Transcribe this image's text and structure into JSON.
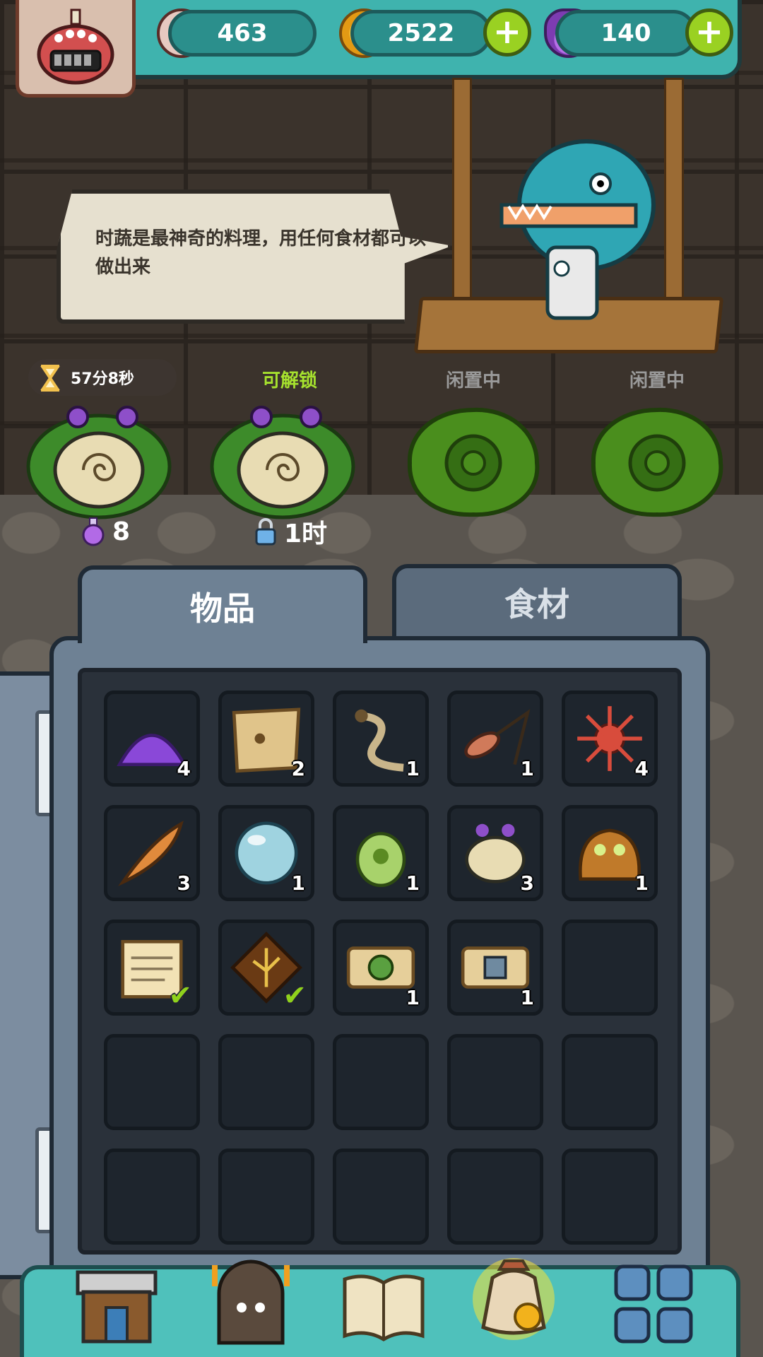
{
  "currency": {
    "eyes": "463",
    "coins": "2522",
    "potions": "140"
  },
  "chef": {
    "speech": "时蔬是最神奇的料理，用任何食材都可以做出来"
  },
  "slots": [
    {
      "status": "57分8秒",
      "bottom_value": "8",
      "bottom_icon": "potion-icon"
    },
    {
      "status": "可解锁",
      "bottom_value": "1时",
      "bottom_icon": "lock-icon"
    },
    {
      "status": "闲置中"
    },
    {
      "status": "闲置中"
    }
  ],
  "colors": {
    "unlock_green": "#a6e22e",
    "idle_gray": "#9a9a9a"
  },
  "tabs": {
    "items": "物品",
    "ingredients": "食材"
  },
  "inventory": [
    {
      "icon": "purple-powder-icon",
      "count": "4"
    },
    {
      "icon": "torn-parchment-icon",
      "count": "2"
    },
    {
      "icon": "snake-tail-icon",
      "count": "1"
    },
    {
      "icon": "slingshot-icon",
      "count": "1"
    },
    {
      "icon": "red-starfish-icon",
      "count": "4"
    },
    {
      "icon": "feather-icon",
      "count": "3"
    },
    {
      "icon": "crystal-orb-icon",
      "count": "1"
    },
    {
      "icon": "green-egg-icon",
      "count": "1"
    },
    {
      "icon": "snail-creature-icon",
      "count": "3"
    },
    {
      "icon": "mud-creature-icon",
      "count": "1"
    },
    {
      "icon": "recipe-scroll-icon",
      "checked": true
    },
    {
      "icon": "treasure-map-icon",
      "checked": true
    },
    {
      "icon": "tower-ticket-green-icon",
      "count": "1"
    },
    {
      "icon": "tower-ticket-steel-icon",
      "count": "1"
    }
  ],
  "bottom_nav": [
    "shop-icon",
    "dungeon-icon",
    "recipe-book-icon",
    "bag-icon",
    "menu-grid-icon"
  ]
}
